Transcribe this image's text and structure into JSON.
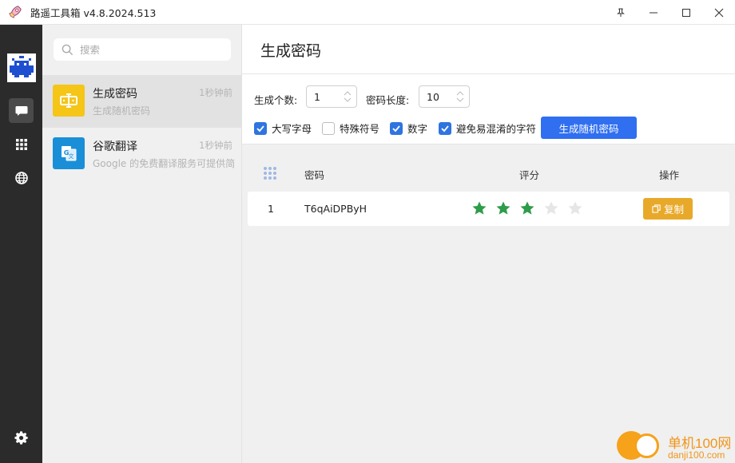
{
  "titlebar": {
    "title": "路遥工具箱 v4.8.2024.513"
  },
  "sidebar": {
    "search_placeholder": "搜索",
    "items": [
      {
        "title": "生成密码",
        "subtitle": "生成随机密码",
        "time": "1秒钟前",
        "icon": "password-generator-icon",
        "color": "#f5c518",
        "active": true
      },
      {
        "title": "谷歌翻译",
        "subtitle": "Google 的免费翻译服务可提供简",
        "time": "1秒钟前",
        "icon": "google-translate-icon",
        "color": "#1a8fd8",
        "active": false
      }
    ]
  },
  "main": {
    "title": "生成密码",
    "count_label": "生成个数:",
    "count_value": "1",
    "length_label": "密码长度:",
    "length_value": "10",
    "options": [
      {
        "label": "大写字母",
        "checked": true
      },
      {
        "label": "特殊符号",
        "checked": false
      },
      {
        "label": "数字",
        "checked": true
      },
      {
        "label": "避免易混淆的字符",
        "checked": true
      }
    ],
    "generate_button": "生成随机密码",
    "table": {
      "headers": [
        "密码",
        "评分",
        "操作"
      ],
      "rows": [
        {
          "index": "1",
          "password": "T6qAiDPByH",
          "rating": 3,
          "rating_max": 5,
          "action": "复制"
        }
      ]
    }
  },
  "watermark": {
    "text": "单机100网",
    "url": "danji100.com"
  },
  "colors": {
    "accent": "#2f6ff0",
    "star": "#2e9c4a",
    "copy": "#e8a92a"
  }
}
